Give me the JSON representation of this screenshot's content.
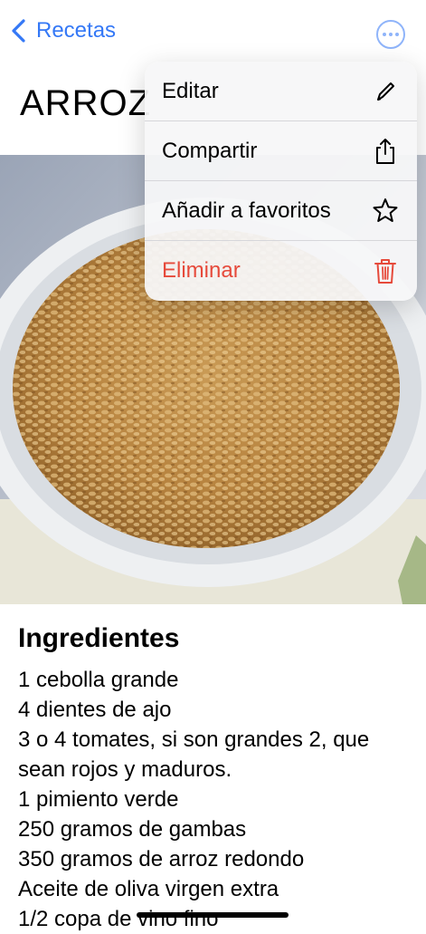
{
  "nav": {
    "back_label": "Recetas"
  },
  "page": {
    "title": "ARROZ"
  },
  "menu": {
    "items": [
      {
        "label": "Editar",
        "icon": "pencil-icon"
      },
      {
        "label": "Compartir",
        "icon": "share-icon"
      },
      {
        "label": "Añadir a favoritos",
        "icon": "star-icon"
      },
      {
        "label": "Eliminar",
        "icon": "trash-icon",
        "color": "#e64a3b"
      }
    ]
  },
  "recipe": {
    "ingredients_heading": "Ingredientes",
    "ingredients": [
      "1 cebolla grande",
      "4 dientes de ajo",
      "3 o 4 tomates, si son grandes 2, que sean rojos y maduros.",
      "1 pimiento verde",
      "250 gramos de gambas",
      "350 gramos de arroz redondo",
      "Aceite de oliva virgen extra",
      "1/2 copa de vino fino"
    ]
  },
  "colors": {
    "accent": "#3478f6",
    "danger": "#e64a3b"
  }
}
